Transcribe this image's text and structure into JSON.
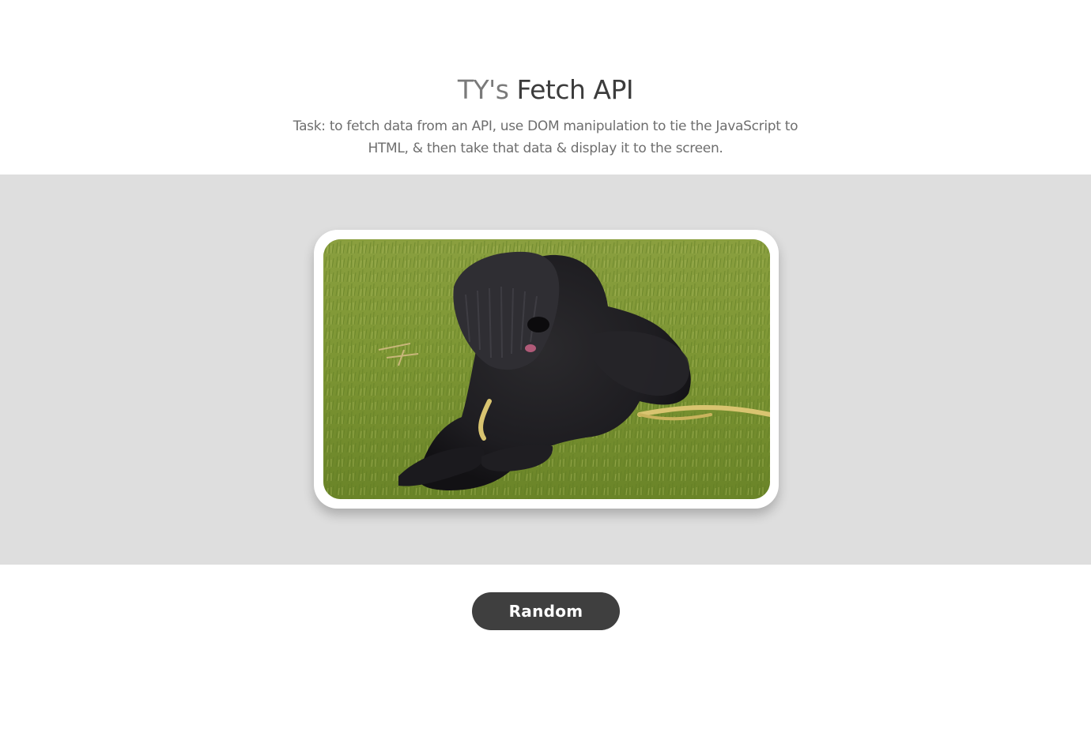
{
  "header": {
    "title_prefix": "TY's",
    "title_main": "Fetch API",
    "description": "Task: to fetch data from an API, use DOM manipulation to tie the JavaScript to HTML, & then take that data & display it to the screen."
  },
  "image": {
    "subject": "dog",
    "background": "grass"
  },
  "controls": {
    "random_label": "Random"
  },
  "colors": {
    "stage_background": "#dedede",
    "button_background": "#3f3f3f",
    "title_main": "#3c3c3c",
    "title_prefix": "#7a7a7a"
  }
}
